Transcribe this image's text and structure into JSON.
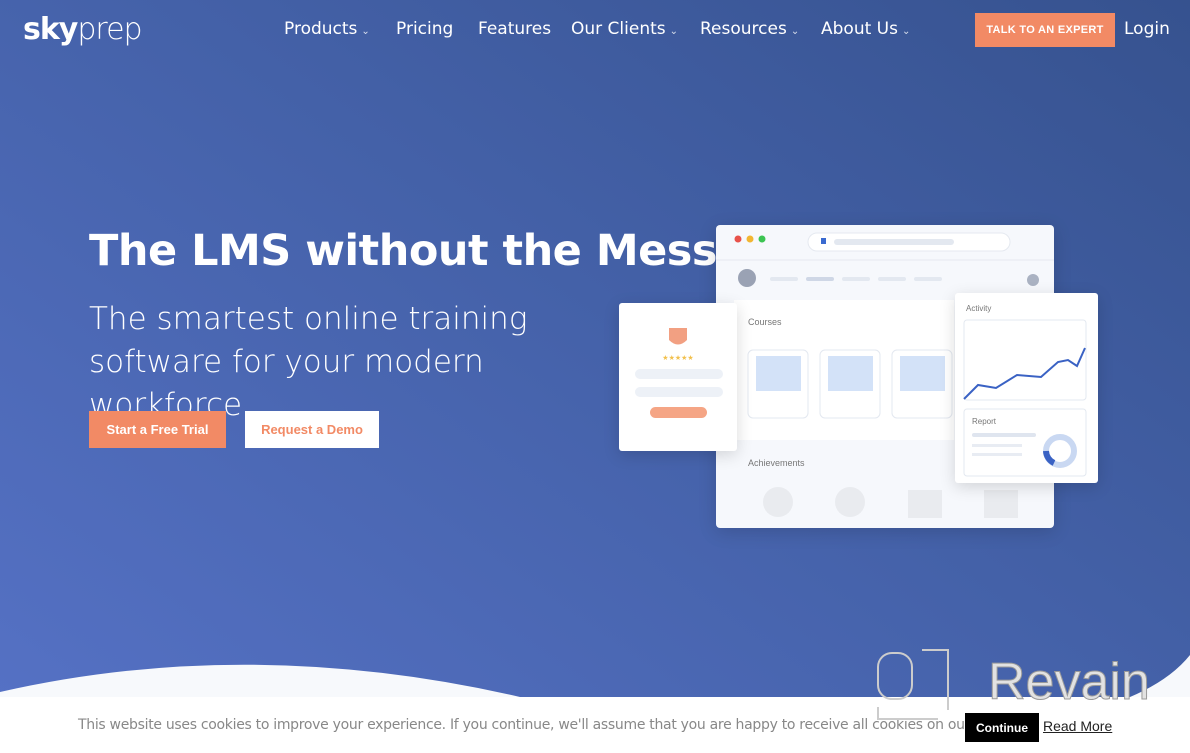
{
  "header": {
    "logo": {
      "bold": "sky",
      "light": "prep"
    },
    "nav": [
      {
        "label": "Products",
        "dropdown": true
      },
      {
        "label": "Pricing",
        "dropdown": false
      },
      {
        "label": "Features",
        "dropdown": false
      },
      {
        "label": "Our Clients",
        "dropdown": true
      },
      {
        "label": "Resources",
        "dropdown": true
      },
      {
        "label": "About Us",
        "dropdown": true
      }
    ],
    "cta": "TALK TO AN EXPERT",
    "login": "Login"
  },
  "hero": {
    "title": "The LMS without the Mess",
    "subtitle": "The smartest online training software for your modern workforce.",
    "primary_button": "Start a Free Trial",
    "secondary_button": "Request a Demo"
  },
  "illustration": {
    "courses": "Courses",
    "achievements": "Achievements",
    "activity": "Activity",
    "report": "Report"
  },
  "cookie": {
    "text": "This website uses cookies to improve your experience. If you continue, we'll assume that you are happy to receive all cookies on our website.",
    "continue": "Continue",
    "read_more": "Read More"
  },
  "watermark": "Revain",
  "colors": {
    "accent": "#f28a65",
    "bg_top": "#36528f",
    "bg_bottom": "#5672c6"
  }
}
